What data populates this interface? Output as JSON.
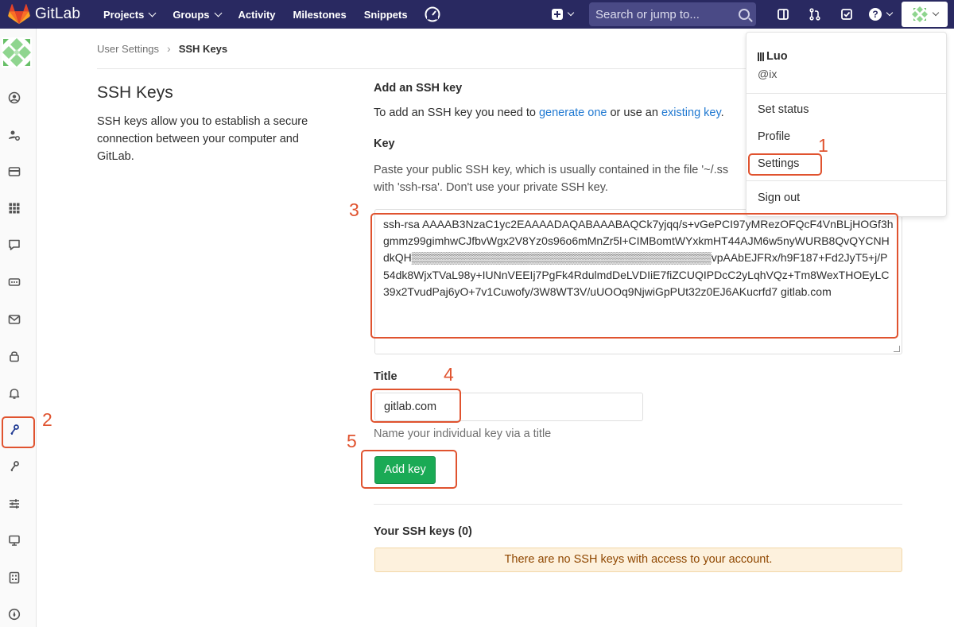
{
  "navbar": {
    "brand": "GitLab",
    "items": [
      {
        "label": "Projects",
        "dropdown": true
      },
      {
        "label": "Groups",
        "dropdown": true
      },
      {
        "label": "Activity",
        "dropdown": false
      },
      {
        "label": "Milestones",
        "dropdown": false
      },
      {
        "label": "Snippets",
        "dropdown": false
      }
    ],
    "search_placeholder": "Search or jump to...",
    "help": "?"
  },
  "breadcrumb": {
    "parent": "User Settings",
    "separator": "›",
    "current": "SSH Keys"
  },
  "page": {
    "title": "SSH Keys",
    "description": "SSH keys allow you to establish a secure connection between your computer and GitLab."
  },
  "add_key": {
    "section_title": "Add an SSH key",
    "intro_before": "To add an SSH key you need to ",
    "intro_link1": "generate one",
    "intro_middle": " or use an ",
    "intro_link2": "existing key",
    "intro_after": ".",
    "key_label": "Key",
    "key_help": "Paste your public SSH key, which is usually contained in the file '~/.ss with 'ssh-rsa'. Don't use your private SSH key.",
    "key_value": "ssh-rsa AAAAB3NzaC1yc2EAAAADAQABAAABAQCk7yjqq/s+vGePCI97yMRezOFQcF4VnBLjHOGf3hgmmz99gimhwCJfbvWgx2V8Yz0s96o6mMnZr5l+CIMBomtWYxkmHT44AJM6w5nyWURB8QvQYCNHdkQH▒▒▒▒▒▒▒▒▒▒▒▒▒▒▒▒▒▒▒▒▒▒▒▒▒▒▒▒▒▒▒▒▒▒▒▒▒▒vpAAbEJFRx/h9F187+Fd2JyT5+j/P54dk8WjxTVaL98y+IUNnVEEIj7PgFk4RdulmdDeLVDIiE7fiZCUQIPDcC2yLqhVQz+Tm8WexTHOEyLC39x2TvudPaj6yO+7v1Cuwofy/3W8WT3V/uUOOq9NjwiGpPUt32z0EJ6AKucrfd7 gitlab.com",
    "title_label": "Title",
    "title_value": "gitlab.com",
    "title_help": "Name your individual key via a title",
    "submit_label": "Add key"
  },
  "your_keys": {
    "heading": "Your SSH keys (0)",
    "empty_message": "There are no SSH keys with access to your account."
  },
  "user_menu": {
    "username": "Luo",
    "handle": "@ix",
    "items": [
      "Set status",
      "Profile",
      "Settings",
      "Sign out"
    ]
  },
  "annotations": [
    "1",
    "2",
    "3",
    "4",
    "5"
  ],
  "colors": {
    "navbar": "#292961",
    "accent_link": "#1f78d1",
    "success_button": "#1aaa55",
    "annotation": "#e0532f",
    "warning_bg": "#fdf1dd"
  }
}
